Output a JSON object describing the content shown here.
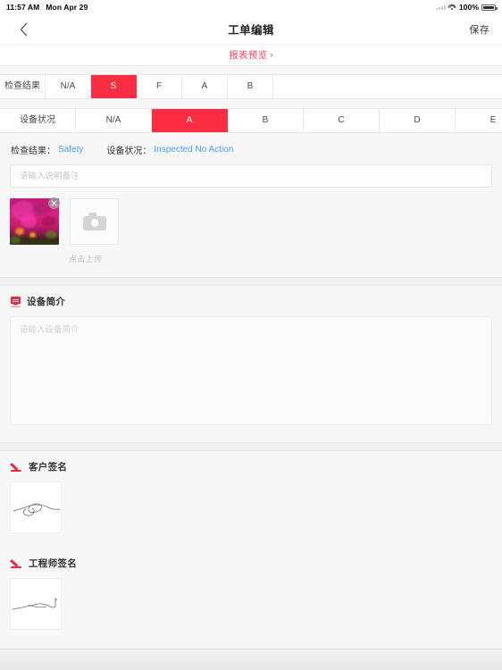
{
  "statusbar": {
    "time": "11:57 AM",
    "date": "Mon Apr 29",
    "battery_percent": "100%",
    "wifi_icon": "wifi-icon",
    "battery_icon": "battery-icon"
  },
  "navbar": {
    "back_icon": "chevron-left-icon",
    "title": "工单编辑",
    "save_label": "保存"
  },
  "preview": {
    "label": "报表预览",
    "chevron": "›"
  },
  "segments": {
    "row1": {
      "label": "检查结果",
      "options": [
        "N/A",
        "S",
        "F",
        "A",
        "B"
      ],
      "selected": "S"
    },
    "row2": {
      "label": "设备状况",
      "options": [
        "N/A",
        "A",
        "B",
        "C",
        "D",
        "E"
      ],
      "selected": "A"
    }
  },
  "result": {
    "check_key": "检查结果：",
    "check_value": "Safety",
    "status_key": "设备状况：",
    "status_value": "Inspected No Action"
  },
  "note": {
    "placeholder": "请输入说明备注",
    "value": ""
  },
  "photos": {
    "upload_label": "点击上传",
    "camera_icon": "camera-icon",
    "delete_icon": "close-circle-icon",
    "items": [
      {
        "name": "flower-photo-thumbnail"
      }
    ]
  },
  "device_intro": {
    "icon": "document-icon",
    "title": "设备简介",
    "placeholder": "请输入设备简介",
    "value": ""
  },
  "customer_signature": {
    "icon": "pen-icon",
    "title": "客户签名"
  },
  "engineer_signature": {
    "icon": "pen-icon",
    "title": "工程师签名"
  },
  "colors": {
    "accent_red": "#fa2d42",
    "link_blue": "#4a9cf0",
    "preview_red": "#f5455c",
    "page_bg": "#f7f7f7"
  }
}
